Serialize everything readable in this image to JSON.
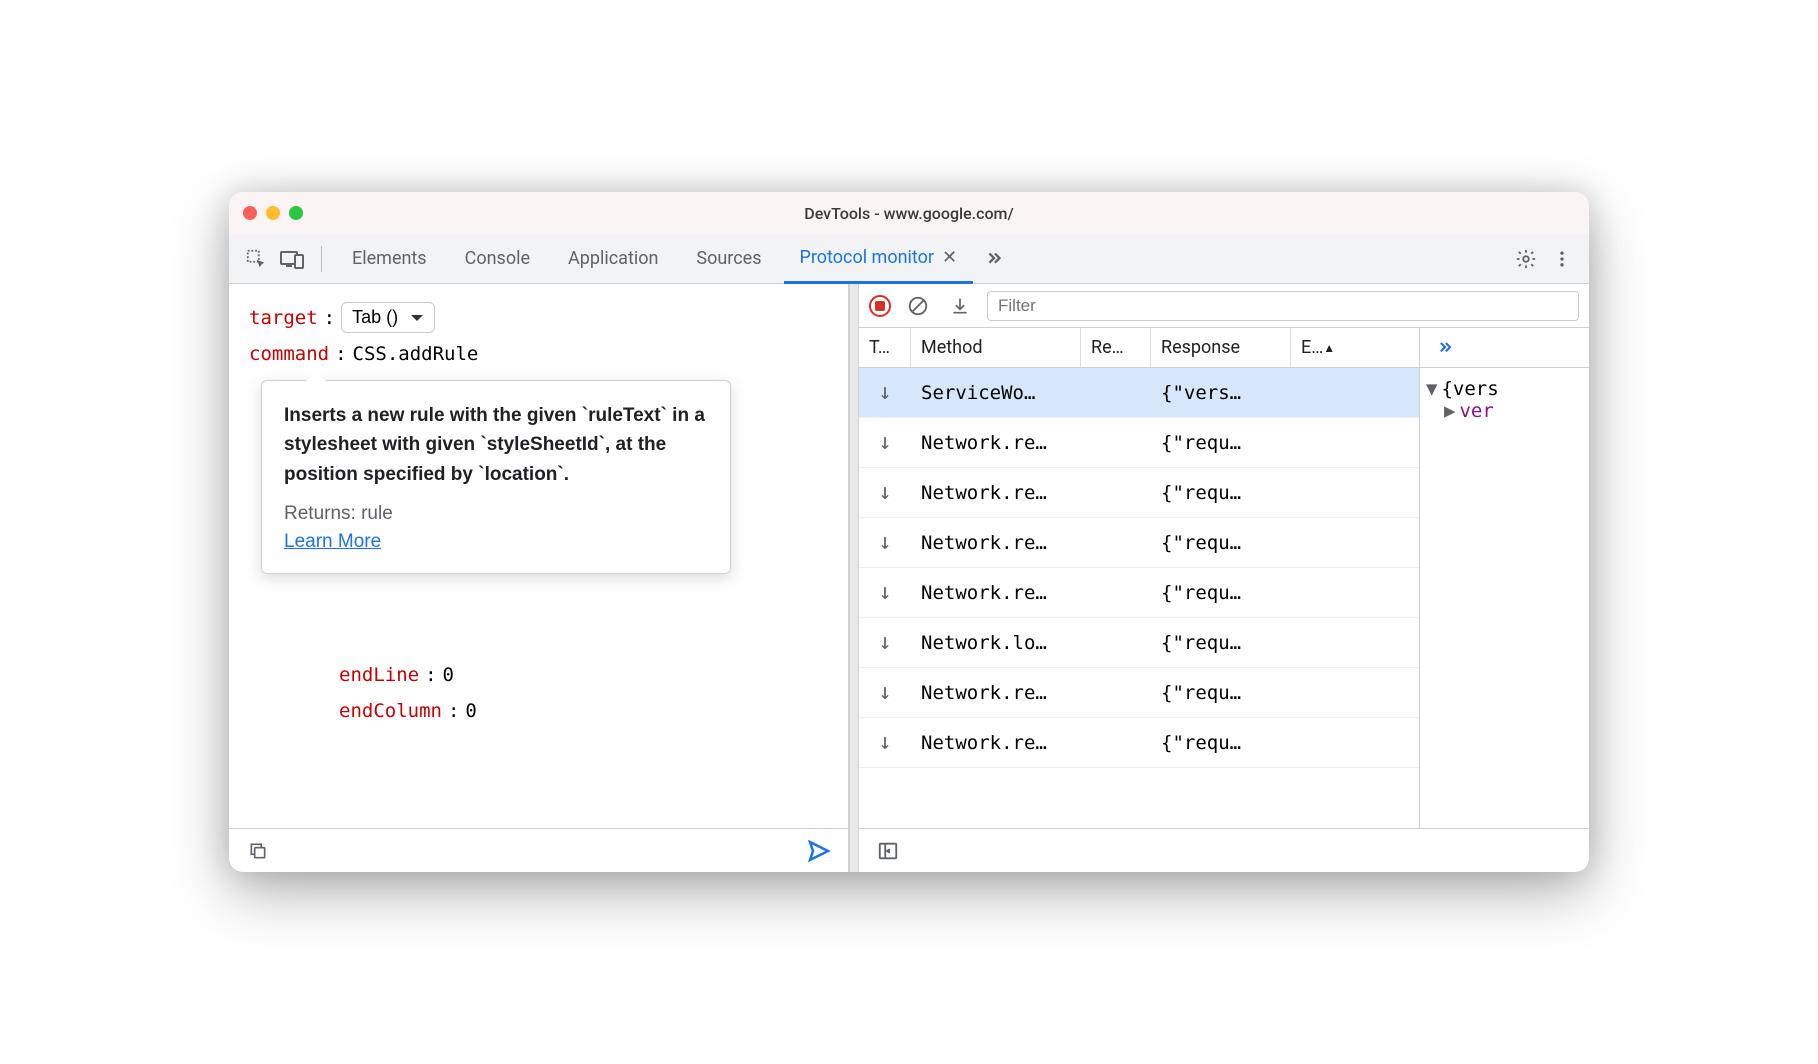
{
  "window": {
    "title": "DevTools - www.google.com/"
  },
  "tabs": {
    "items": [
      "Elements",
      "Console",
      "Application",
      "Sources",
      "Protocol monitor"
    ],
    "activeIndex": 4
  },
  "editor": {
    "target_label": "target",
    "target_value": "Tab ()",
    "command_label": "command",
    "command_value": "CSS.addRule",
    "nested": {
      "endLine_label": "endLine",
      "endLine_value": "0",
      "endColumn_label": "endColumn",
      "endColumn_value": "0"
    }
  },
  "tooltip": {
    "description": "Inserts a new rule with the given `ruleText` in a stylesheet with given `styleSheetId`, at the position specified by `location`.",
    "returns": "Returns: rule",
    "learn": "Learn More"
  },
  "monitor": {
    "filter_placeholder": "Filter",
    "columns": [
      "T…",
      "Method",
      "Re…",
      "Response",
      "E…"
    ],
    "rows": [
      {
        "method": "ServiceWo…",
        "request": "",
        "response": "{\"vers…"
      },
      {
        "method": "Network.re…",
        "request": "",
        "response": "{\"requ…"
      },
      {
        "method": "Network.re…",
        "request": "",
        "response": "{\"requ…"
      },
      {
        "method": "Network.re…",
        "request": "",
        "response": "{\"requ…"
      },
      {
        "method": "Network.re…",
        "request": "",
        "response": "{\"requ…"
      },
      {
        "method": "Network.lo…",
        "request": "",
        "response": "{\"requ…"
      },
      {
        "method": "Network.re…",
        "request": "",
        "response": "{\"requ…"
      },
      {
        "method": "Network.re…",
        "request": "",
        "response": "{\"requ…"
      }
    ]
  },
  "detail": {
    "root": "{vers",
    "prop": "ver"
  }
}
